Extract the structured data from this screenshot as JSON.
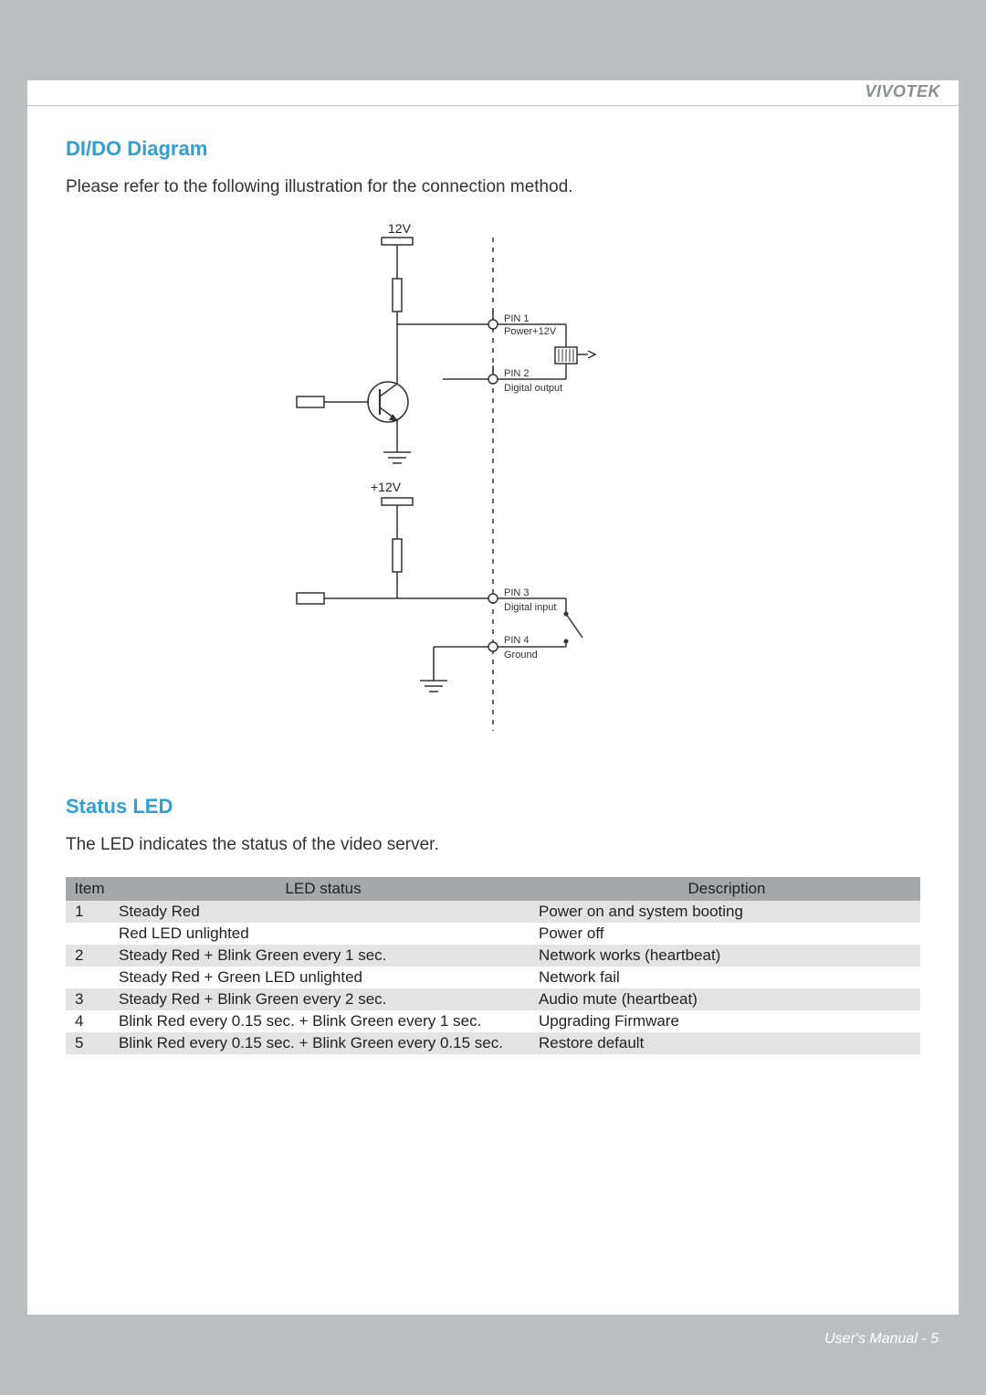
{
  "brand": "VIVOTEK",
  "section1": {
    "title": "DI/DO Diagram",
    "intro": "Please refer to the following illustration for the connection method."
  },
  "diagram": {
    "top_voltage": "12V",
    "mid_voltage": "+12V",
    "pin1_label": "PIN 1",
    "pin1_desc": "Power+12V",
    "pin2_label": "PIN 2",
    "pin2_desc": "Digital output",
    "pin3_label": "PIN 3",
    "pin3_desc": "Digital input",
    "pin4_label": "PIN 4",
    "pin4_desc": "Ground"
  },
  "section2": {
    "title": "Status LED",
    "intro": "The LED indicates the status of the video server."
  },
  "table": {
    "headers": {
      "item": "Item",
      "status": "LED status",
      "desc": "Description"
    },
    "rows": [
      {
        "item": "1",
        "status": "Steady Red",
        "desc": "Power on and system booting",
        "shade": true
      },
      {
        "item": "",
        "status": "Red LED unlighted",
        "desc": "Power off",
        "shade": false
      },
      {
        "item": "2",
        "status": "Steady Red + Blink Green every 1 sec.",
        "desc": "Network works (heartbeat)",
        "shade": true
      },
      {
        "item": "",
        "status": "Steady Red + Green LED unlighted",
        "desc": "Network fail",
        "shade": false
      },
      {
        "item": "3",
        "status": "Steady Red + Blink Green every 2 sec.",
        "desc": "Audio mute (heartbeat)",
        "shade": true
      },
      {
        "item": "4",
        "status": "Blink Red every 0.15 sec. + Blink Green every 1 sec.",
        "desc": "Upgrading Firmware",
        "shade": false
      },
      {
        "item": "5",
        "status": "Blink Red every 0.15 sec. + Blink Green every 0.15 sec.",
        "desc": "Restore default",
        "shade": true
      }
    ]
  },
  "footer": "User's Manual - 5"
}
